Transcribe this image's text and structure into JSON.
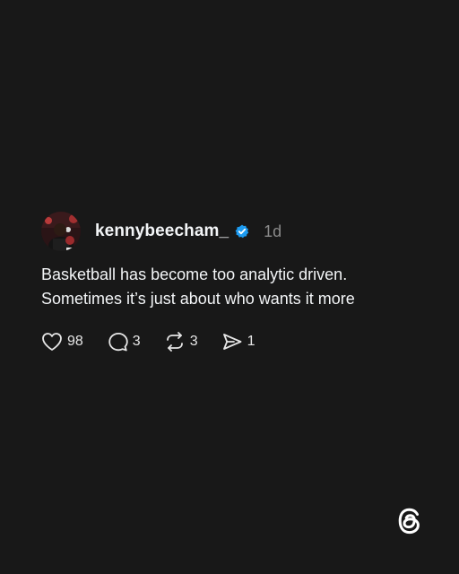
{
  "post": {
    "username": "kennybeecham_",
    "time": "1d",
    "text_lines": [
      "Basketball has become too analytic driven.",
      "Sometimes it’s just about who wants it more"
    ],
    "actions": {
      "likes": "98",
      "replies": "3",
      "reposts": "3",
      "shares": "1"
    },
    "icons": {
      "like": "heart-icon",
      "reply": "comment-icon",
      "repost": "repost-icon",
      "share": "send-icon",
      "verified": "verified-badge-icon",
      "brand": "threads-logo-icon"
    }
  },
  "colors": {
    "background": "#181818",
    "text": "#f3f5f7",
    "muted": "#8a8a8a",
    "verified": "#1d9bf0"
  }
}
